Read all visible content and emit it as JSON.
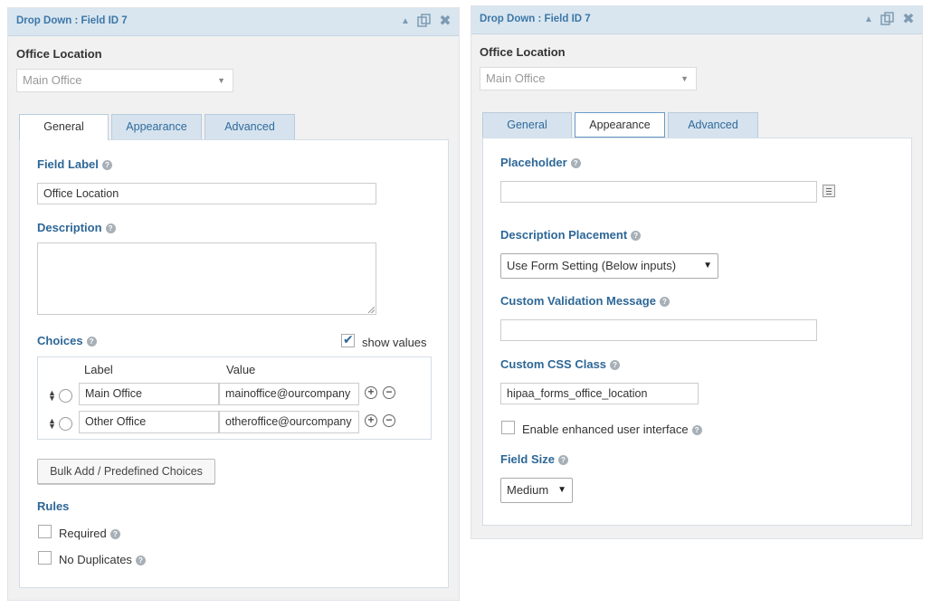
{
  "left_panel": {
    "title": "Drop Down : Field ID 7",
    "field_name": "Office Location",
    "preview_select_value": "Main Office",
    "tabs": [
      {
        "label": "General"
      },
      {
        "label": "Appearance"
      },
      {
        "label": "Advanced"
      }
    ],
    "field_label": {
      "label": "Field Label",
      "value": "Office Location"
    },
    "description": {
      "label": "Description",
      "value": ""
    },
    "choices": {
      "label": "Choices",
      "show_values_label": "show values",
      "show_values_checked": true,
      "col_label": "Label",
      "col_value": "Value",
      "rows": [
        {
          "label": "Main Office",
          "value": "mainoffice@ourcompany"
        },
        {
          "label": "Other Office",
          "value": "otheroffice@ourcompany"
        }
      ]
    },
    "bulk_add_label": "Bulk Add / Predefined Choices",
    "rules": {
      "label": "Rules",
      "required_label": "Required",
      "no_duplicates_label": "No Duplicates"
    }
  },
  "right_panel": {
    "title": "Drop Down : Field ID 7",
    "field_name": "Office Location",
    "preview_select_value": "Main Office",
    "tabs": [
      {
        "label": "General"
      },
      {
        "label": "Appearance"
      },
      {
        "label": "Advanced"
      }
    ],
    "placeholder": {
      "label": "Placeholder",
      "value": ""
    },
    "description_placement": {
      "label": "Description Placement",
      "value": "Use Form Setting (Below inputs)"
    },
    "custom_validation": {
      "label": "Custom Validation Message",
      "value": ""
    },
    "custom_css": {
      "label": "Custom CSS Class",
      "value": "hipaa_forms_office_location"
    },
    "enhanced_ui_label": "Enable enhanced user interface",
    "field_size": {
      "label": "Field Size",
      "value": "Medium"
    }
  },
  "colors": {
    "header_bg": "#d9e6ef",
    "label_blue": "#2d6797",
    "tab_bg": "#d6e3ee",
    "panel_bg": "#f1f1f1"
  }
}
